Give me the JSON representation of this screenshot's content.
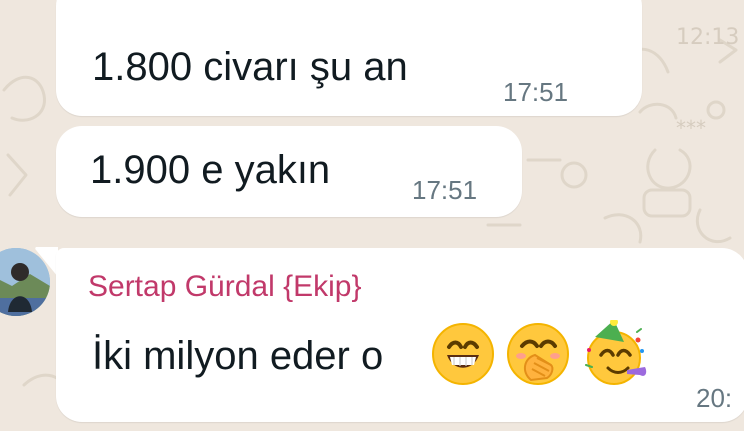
{
  "messages": [
    {
      "text": "1.800 civarı şu an",
      "time": "17:51"
    },
    {
      "text": "1.900 e yakın",
      "time": "17:51"
    },
    {
      "sender": "Sertap Gürdal {Ekip}",
      "text": "İki milyon eder o",
      "time": "20:",
      "emojis": [
        "grinning-face-with-smiling-eyes-emoji",
        "face-with-hand-over-mouth-emoji",
        "partying-face-emoji"
      ]
    }
  ],
  "colors": {
    "chat_background": "#efe7de",
    "bubble": "#ffffff",
    "sender_name": "#c1396a",
    "message_text": "#111b21",
    "timestamp": "#667781"
  }
}
